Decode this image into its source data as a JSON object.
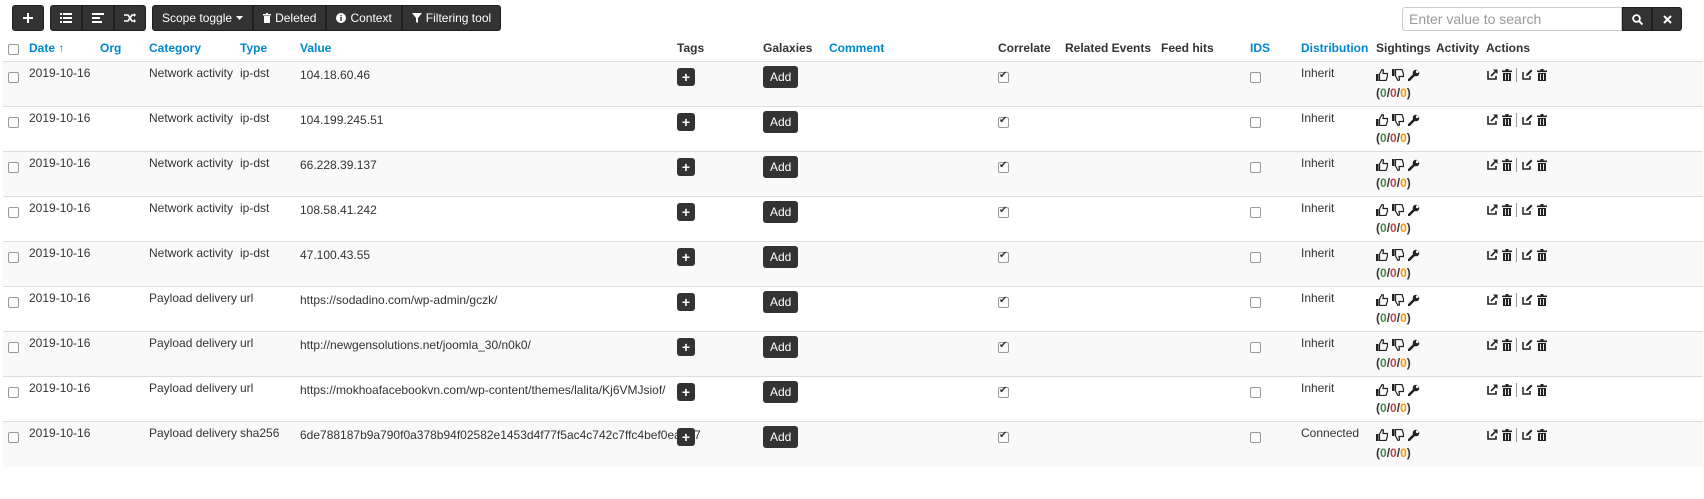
{
  "toolbar": {
    "scope_toggle": "Scope toggle",
    "deleted": "Deleted",
    "context": "Context",
    "filtering_tool": "Filtering tool"
  },
  "search": {
    "placeholder": "Enter value to search"
  },
  "columns": {
    "date": "Date",
    "org": "Org",
    "category": "Category",
    "type": "Type",
    "value": "Value",
    "tags": "Tags",
    "galaxies": "Galaxies",
    "comment": "Comment",
    "correlate": "Correlate",
    "related_events": "Related Events",
    "feed_hits": "Feed hits",
    "ids": "IDS",
    "distribution": "Distribution",
    "sightings": "Sightings",
    "activity": "Activity",
    "actions": "Actions"
  },
  "rows": [
    {
      "date": "2019-10-16",
      "category": "Network activity",
      "type": "ip-dst",
      "value": "104.18.60.46",
      "add": "Add",
      "distribution": "Inherit",
      "sightings": {
        "pos": "0",
        "neg": "0",
        "exp": "0"
      }
    },
    {
      "date": "2019-10-16",
      "category": "Network activity",
      "type": "ip-dst",
      "value": "104.199.245.51",
      "add": "Add",
      "distribution": "Inherit",
      "sightings": {
        "pos": "0",
        "neg": "0",
        "exp": "0"
      }
    },
    {
      "date": "2019-10-16",
      "category": "Network activity",
      "type": "ip-dst",
      "value": "66.228.39.137",
      "add": "Add",
      "distribution": "Inherit",
      "sightings": {
        "pos": "0",
        "neg": "0",
        "exp": "0"
      }
    },
    {
      "date": "2019-10-16",
      "category": "Network activity",
      "type": "ip-dst",
      "value": "108.58.41.242",
      "add": "Add",
      "distribution": "Inherit",
      "sightings": {
        "pos": "0",
        "neg": "0",
        "exp": "0"
      }
    },
    {
      "date": "2019-10-16",
      "category": "Network activity",
      "type": "ip-dst",
      "value": "47.100.43.55",
      "add": "Add",
      "distribution": "Inherit",
      "sightings": {
        "pos": "0",
        "neg": "0",
        "exp": "0"
      }
    },
    {
      "date": "2019-10-16",
      "category": "Payload delivery",
      "type": "url",
      "value": "https://sodadino.com/wp-admin/gczk/",
      "add": "Add",
      "distribution": "Inherit",
      "sightings": {
        "pos": "0",
        "neg": "0",
        "exp": "0"
      }
    },
    {
      "date": "2019-10-16",
      "category": "Payload delivery",
      "type": "url",
      "value": "http://newgensolutions.net/joomla_30/n0k0/",
      "add": "Add",
      "distribution": "Inherit",
      "sightings": {
        "pos": "0",
        "neg": "0",
        "exp": "0"
      }
    },
    {
      "date": "2019-10-16",
      "category": "Payload delivery",
      "type": "url",
      "value": "https://mokhoafacebookvn.com/wp-content/themes/lalita/Kj6VMJsiof/",
      "add": "Add",
      "distribution": "Inherit",
      "sightings": {
        "pos": "0",
        "neg": "0",
        "exp": "0"
      }
    },
    {
      "date": "2019-10-16",
      "category": "Payload delivery",
      "type": "sha256",
      "value": "6de788187b9a790f0a378b94f02582e1453d4f77f5ac4c742c7ffc4bef0ea157",
      "add": "Add",
      "distribution": "Connected",
      "sightings": {
        "pos": "0",
        "neg": "0",
        "exp": "0"
      }
    }
  ]
}
